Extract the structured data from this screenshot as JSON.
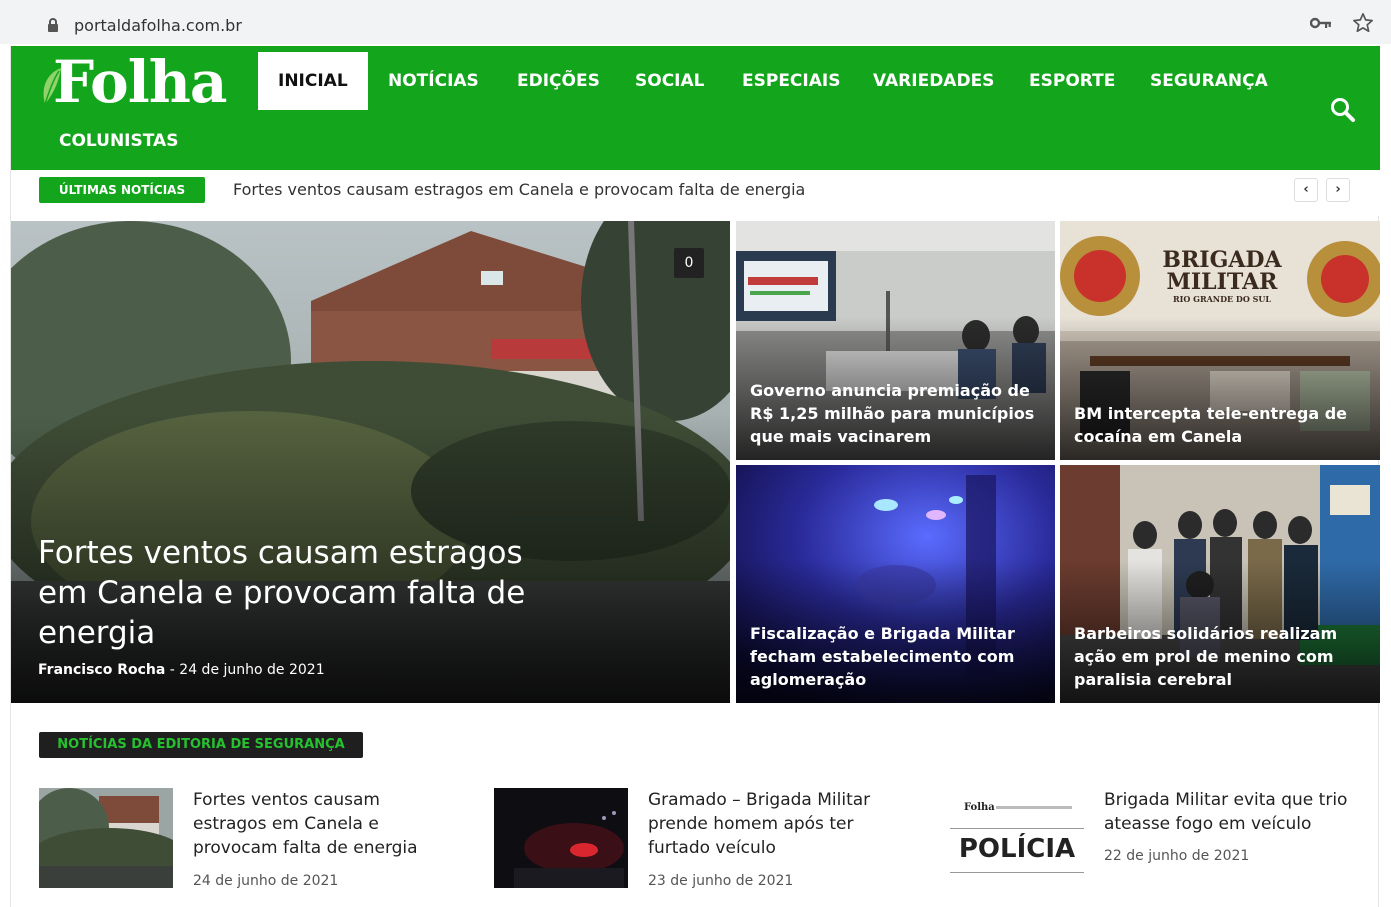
{
  "browser": {
    "url": "portaldafolha.com.br",
    "lock_icon": "lock-icon",
    "key_icon": "key-icon",
    "star_icon": "star-icon"
  },
  "header": {
    "logo_text": "Folha",
    "brand_color": "#13a61c",
    "nav": [
      "INICIAL",
      "NOTÍCIAS",
      "EDIÇÕES",
      "SOCIAL",
      "ESPECIAIS",
      "VARIEDADES",
      "ESPORTE",
      "SEGURANÇA",
      "COLUNISTAS"
    ],
    "active_nav": "INICIAL",
    "search_icon": "search-icon"
  },
  "breaking": {
    "label": "ÚLTIMAS NOTÍCIAS",
    "headline": "Fortes ventos causam estragos em Canela e provocam falta de energia",
    "prev": "‹",
    "next": "›"
  },
  "hero": {
    "main": {
      "title": "Fortes ventos causam estragos em Canela e provocam falta de energia",
      "author": "Francisco Rocha",
      "separator": "-",
      "date": "24 de junho de 2021",
      "comments": "0"
    },
    "tiles": [
      {
        "title": "Governo anuncia premiação de R$ 1,25 milhão para municípios que mais vacinarem"
      },
      {
        "title": "BM intercepta tele-entrega de cocaína em Canela",
        "sign_line1": "BRIGADA",
        "sign_line2": "MILITAR",
        "sign_line3": "RIO GRANDE DO SUL"
      },
      {
        "title": "Fiscalização e Brigada Militar fecham estabelecimento com aglomeração"
      },
      {
        "title": "Barbeiros solidários realizam ação em prol de menino com paralisia cerebral"
      }
    ]
  },
  "section": {
    "label": "NOTÍCIAS DA EDITORIA DE SEGURANÇA",
    "cards": [
      {
        "title": "Fortes ventos causam estragos em Canela e provocam falta de energia",
        "date": "24 de junho de 2021"
      },
      {
        "title": "Gramado – Brigada Militar prende homem após ter furtado veículo",
        "date": "23 de junho de 2021"
      },
      {
        "title": "Brigada Militar evita que trio ateasse fogo em veículo",
        "date": "22 de junho de 2021",
        "thumb_brand": "Folha",
        "thumb_word": "POLÍCIA"
      }
    ]
  }
}
